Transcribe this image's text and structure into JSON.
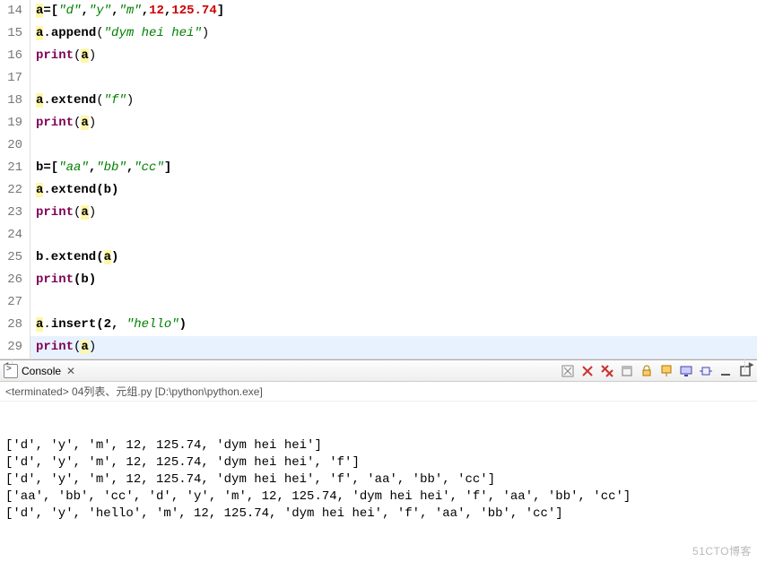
{
  "editor": {
    "lines": [
      {
        "num": 14,
        "tokens": [
          {
            "t": "a",
            "cls": "tok-hl tok-method"
          },
          {
            "t": "=[",
            "cls": "tok-punct tok-method"
          },
          {
            "t": "\"d\"",
            "cls": "tok-str"
          },
          {
            "t": ",",
            "cls": "tok-punct tok-method"
          },
          {
            "t": "\"y\"",
            "cls": "tok-str"
          },
          {
            "t": ",",
            "cls": "tok-punct tok-method"
          },
          {
            "t": "\"m\"",
            "cls": "tok-str"
          },
          {
            "t": ",",
            "cls": "tok-punct tok-method"
          },
          {
            "t": "12",
            "cls": "tok-num-red"
          },
          {
            "t": ",",
            "cls": "tok-punct tok-method"
          },
          {
            "t": "125.74",
            "cls": "tok-num-red"
          },
          {
            "t": "]",
            "cls": "tok-punct tok-method"
          }
        ]
      },
      {
        "num": 15,
        "tokens": [
          {
            "t": "a",
            "cls": "tok-hl tok-method"
          },
          {
            "t": ".",
            "cls": "tok-punct"
          },
          {
            "t": "append",
            "cls": "tok-method"
          },
          {
            "t": "(",
            "cls": "tok-punct"
          },
          {
            "t": "\"dym hei hei\"",
            "cls": "tok-str"
          },
          {
            "t": ")",
            "cls": "tok-punct"
          }
        ]
      },
      {
        "num": 16,
        "tokens": [
          {
            "t": "print",
            "cls": "tok-kw"
          },
          {
            "t": "(",
            "cls": "tok-punct"
          },
          {
            "t": "a",
            "cls": "tok-hl tok-method"
          },
          {
            "t": ")",
            "cls": "tok-punct"
          }
        ]
      },
      {
        "num": 17,
        "tokens": []
      },
      {
        "num": 18,
        "tokens": [
          {
            "t": "a",
            "cls": "tok-hl tok-method"
          },
          {
            "t": ".",
            "cls": "tok-punct"
          },
          {
            "t": "extend",
            "cls": "tok-method"
          },
          {
            "t": "(",
            "cls": "tok-punct"
          },
          {
            "t": "\"f\"",
            "cls": "tok-str"
          },
          {
            "t": ")",
            "cls": "tok-punct"
          }
        ]
      },
      {
        "num": 19,
        "tokens": [
          {
            "t": "print",
            "cls": "tok-kw"
          },
          {
            "t": "(",
            "cls": "tok-punct"
          },
          {
            "t": "a",
            "cls": "tok-hl tok-method"
          },
          {
            "t": ")",
            "cls": "tok-punct"
          }
        ]
      },
      {
        "num": 20,
        "tokens": []
      },
      {
        "num": 21,
        "tokens": [
          {
            "t": "b=[",
            "cls": "tok-method"
          },
          {
            "t": "\"aa\"",
            "cls": "tok-str"
          },
          {
            "t": ",",
            "cls": "tok-punct tok-method"
          },
          {
            "t": "\"bb\"",
            "cls": "tok-str"
          },
          {
            "t": ",",
            "cls": "tok-punct tok-method"
          },
          {
            "t": "\"cc\"",
            "cls": "tok-str"
          },
          {
            "t": "]",
            "cls": "tok-punct tok-method"
          }
        ]
      },
      {
        "num": 22,
        "tokens": [
          {
            "t": "a",
            "cls": "tok-hl tok-method"
          },
          {
            "t": ".",
            "cls": "tok-punct"
          },
          {
            "t": "extend",
            "cls": "tok-method"
          },
          {
            "t": "(b)",
            "cls": "tok-method"
          }
        ]
      },
      {
        "num": 23,
        "tokens": [
          {
            "t": "print",
            "cls": "tok-kw"
          },
          {
            "t": "(",
            "cls": "tok-punct"
          },
          {
            "t": "a",
            "cls": "tok-hl tok-method"
          },
          {
            "t": ")",
            "cls": "tok-punct"
          }
        ]
      },
      {
        "num": 24,
        "tokens": []
      },
      {
        "num": 25,
        "tokens": [
          {
            "t": "b.extend(",
            "cls": "tok-method"
          },
          {
            "t": "a",
            "cls": "tok-hl tok-method"
          },
          {
            "t": ")",
            "cls": "tok-method"
          }
        ]
      },
      {
        "num": 26,
        "tokens": [
          {
            "t": "print",
            "cls": "tok-kw"
          },
          {
            "t": "(b)",
            "cls": "tok-method"
          }
        ]
      },
      {
        "num": 27,
        "tokens": []
      },
      {
        "num": 28,
        "tokens": [
          {
            "t": "a",
            "cls": "tok-hl tok-method"
          },
          {
            "t": ".",
            "cls": "tok-punct"
          },
          {
            "t": "insert",
            "cls": "tok-method"
          },
          {
            "t": "(2, ",
            "cls": "tok-method"
          },
          {
            "t": "\"hello\"",
            "cls": "tok-str"
          },
          {
            "t": ")",
            "cls": "tok-method"
          }
        ]
      },
      {
        "num": 29,
        "current": true,
        "tokens": [
          {
            "t": "print",
            "cls": "tok-kw"
          },
          {
            "t": "(",
            "cls": "tok-punct"
          },
          {
            "t": "a",
            "cls": "tok-hl tok-method"
          },
          {
            "t": ")",
            "cls": "tok-punct"
          }
        ]
      }
    ]
  },
  "console": {
    "title": "Console",
    "close_x": "✕",
    "subheader": "<terminated> 04列表、元组.py [D:\\python\\python.exe]",
    "output": [
      "['d', 'y', 'm', 12, 125.74, 'dym hei hei']",
      "['d', 'y', 'm', 12, 125.74, 'dym hei hei', 'f']",
      "['d', 'y', 'm', 12, 125.74, 'dym hei hei', 'f', 'aa', 'bb', 'cc']",
      "['aa', 'bb', 'cc', 'd', 'y', 'm', 12, 125.74, 'dym hei hei', 'f', 'aa', 'bb', 'cc']",
      "['d', 'y', 'hello', 'm', 12, 125.74, 'dym hei hei', 'f', 'aa', 'bb', 'cc']"
    ],
    "watermark": "51CTO博客"
  },
  "toolbar_icons": [
    "remove-launch-icon",
    "remove-all-icon",
    "clear-icon",
    "scroll-lock-icon",
    "pin-icon",
    "display-icon",
    "minimize-icon",
    "maximize-icon"
  ]
}
